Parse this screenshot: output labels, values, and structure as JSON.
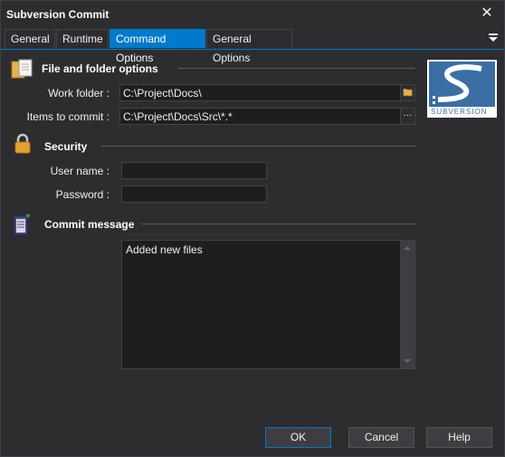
{
  "window": {
    "title": "Subversion Commit",
    "close_glyph": "✕"
  },
  "tabs": [
    {
      "label": "General"
    },
    {
      "label": "Runtime"
    },
    {
      "label": "Command Options",
      "active": true
    },
    {
      "label": "General Options"
    }
  ],
  "sections": {
    "files": {
      "title": "File and folder options",
      "icon": "folder-files-icon",
      "work_folder_label": "Work folder :",
      "work_folder_value": "C:\\Project\\Docs\\",
      "items_label": "Items to commit :",
      "items_value": "C:\\Project\\Docs\\Src\\*.*",
      "items_button": "···"
    },
    "security": {
      "title": "Security",
      "icon": "padlock-icon",
      "username_label": "User name :",
      "username_value": "",
      "password_label": "Password :",
      "password_value": ""
    },
    "message": {
      "title": "Commit message",
      "icon": "notes-icon",
      "text": "Added new files"
    }
  },
  "logo": {
    "text": "SUBVERSION",
    "brand_color": "#3a6ea5"
  },
  "buttons": {
    "ok": "OK",
    "cancel": "Cancel",
    "help": "Help"
  },
  "colors": {
    "accent": "#007acc",
    "background": "#2d2d30",
    "field": "#1e1e1e"
  }
}
